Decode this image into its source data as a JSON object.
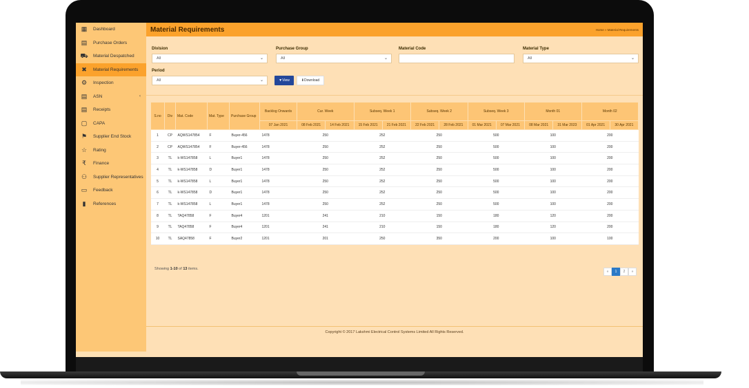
{
  "sidebar": {
    "items": [
      {
        "label": "Dashboard",
        "icon": "▦"
      },
      {
        "label": "Purchase Orders",
        "icon": "▤"
      },
      {
        "label": "Material Despatched",
        "icon": "⛟"
      },
      {
        "label": "Material Requirements",
        "icon": "✖"
      },
      {
        "label": "Inspection",
        "icon": "⚙"
      },
      {
        "label": "ASN",
        "icon": "▤"
      },
      {
        "label": "Receipts",
        "icon": "▤"
      },
      {
        "label": "CAPA",
        "icon": "▢"
      },
      {
        "label": "Supplier End Stock",
        "icon": "⚑"
      },
      {
        "label": "Rating",
        "icon": "☆"
      },
      {
        "label": "Finance",
        "icon": "₹"
      },
      {
        "label": "Supplier Representatives",
        "icon": "⚇"
      },
      {
        "label": "Feedback",
        "icon": "▭"
      },
      {
        "label": "References",
        "icon": "▮"
      }
    ],
    "asn_chevron": "‹"
  },
  "header": {
    "title": "Material Requirements",
    "breadcrumb": "Home  »  Material Requirements"
  },
  "filters": {
    "division": {
      "label": "Division",
      "value": "All"
    },
    "purchase_group": {
      "label": "Purchase Group",
      "value": "All"
    },
    "material_code": {
      "label": "Material Code",
      "value": ""
    },
    "material_type": {
      "label": "Material Type",
      "value": "All"
    },
    "period": {
      "label": "Period",
      "value": "All"
    },
    "view_label": "▼View",
    "download_label": "⬇Download"
  },
  "table": {
    "headers": {
      "sno": "S.no",
      "div": "Div",
      "mat_code": "Mat. Code",
      "mat_type": "Mat. Type",
      "purchase_group": "Purchase Group",
      "backlog": "Backlog Onwards",
      "cur_week": "Cur. Week",
      "sub1": "Subseq. Week 1",
      "sub2": "Subseq. Week 2",
      "sub3": "Subseq. Week 3",
      "month1": "Month 01",
      "month2": "Month 02"
    },
    "dates": [
      "07 Jan 2021",
      "08 Feb 2021",
      "14 Feb 2021",
      "15 Feb 2021",
      "21 Feb 2021",
      "22 Feb 2021",
      "28 Feb 2021",
      "01 Mar 2021",
      "07 Mar 2021",
      "08 Mar 2021",
      "31 Mar 2023",
      "01 Apr 2021",
      "30 Apr 2021"
    ],
    "rows": [
      [
        "1",
        "CP",
        "AQWS147854",
        "F",
        "Buyer-456",
        "1478",
        "250",
        "252",
        "250",
        "500",
        "100",
        "200"
      ],
      [
        "2",
        "CP",
        "AQWS147854",
        "F",
        "Buyer-456",
        "1478",
        "250",
        "252",
        "250",
        "500",
        "100",
        "200"
      ],
      [
        "3",
        "TL",
        "k-WS147858",
        "L",
        "Buyer1",
        "1478",
        "250",
        "252",
        "250",
        "500",
        "100",
        "200"
      ],
      [
        "4",
        "TL",
        "k-WS147858",
        "D",
        "Buyer1",
        "1478",
        "250",
        "252",
        "250",
        "500",
        "100",
        "200"
      ],
      [
        "5",
        "TL",
        "k-WS147858",
        "L",
        "Buyer1",
        "1478",
        "250",
        "252",
        "250",
        "500",
        "100",
        "200"
      ],
      [
        "6",
        "TL",
        "k-WS147858",
        "D",
        "Buyer1",
        "1478",
        "250",
        "252",
        "250",
        "500",
        "100",
        "200"
      ],
      [
        "7",
        "TL",
        "k-WS147858",
        "L",
        "Buyer1",
        "1478",
        "250",
        "252",
        "250",
        "500",
        "100",
        "200"
      ],
      [
        "8",
        "TL",
        "TAQ47858",
        "F",
        "Buyer4",
        "1201",
        "241",
        "210",
        "150",
        "180",
        "120",
        "200"
      ],
      [
        "9",
        "TL",
        "TAQ47858",
        "F",
        "Buyer4",
        "1201",
        "241",
        "210",
        "150",
        "180",
        "120",
        "200"
      ],
      [
        "10",
        "TL",
        "SAQ47858",
        "F",
        "Buyer2",
        "1201",
        "201",
        "250",
        "350",
        "200",
        "100",
        "100"
      ]
    ]
  },
  "showing": {
    "prefix": "Showing ",
    "range": "1-10",
    "mid": " of ",
    "total": "13",
    "suffix": " items."
  },
  "pagination": [
    "«",
    "1",
    "2",
    "»"
  ],
  "footer": "Copyright © 2017 Lakshmi Electrical Control Systems Limited All Rights Reserved."
}
